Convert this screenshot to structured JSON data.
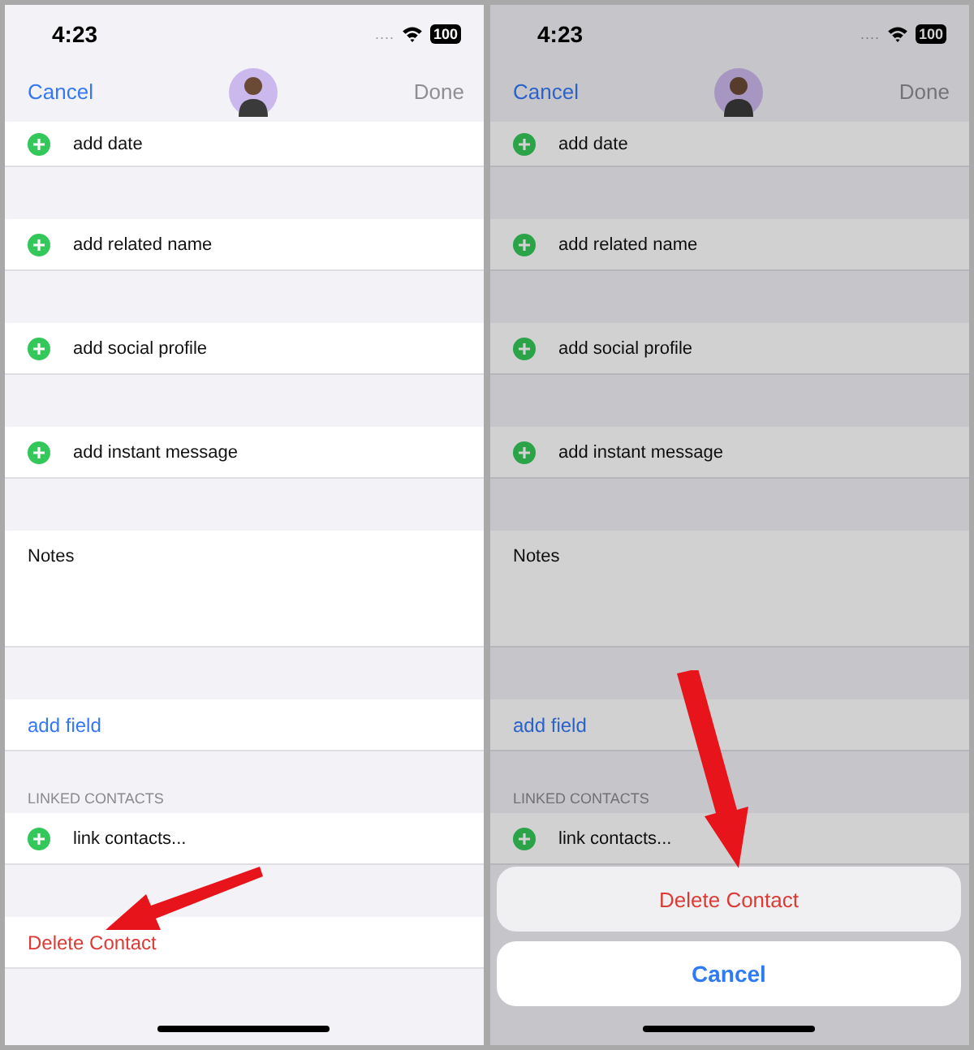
{
  "screens": [
    {
      "status": {
        "time": "4:23",
        "signal": "....",
        "battery": "100"
      },
      "nav": {
        "cancel": "Cancel",
        "done": "Done",
        "done_disabled": true
      },
      "dimmed": false,
      "groups": [
        {
          "rows": [
            {
              "kind": "add",
              "label": "add date"
            }
          ]
        },
        {
          "rows": [
            {
              "kind": "add",
              "label": "add related name"
            }
          ]
        },
        {
          "rows": [
            {
              "kind": "add",
              "label": "add social profile"
            }
          ]
        },
        {
          "rows": [
            {
              "kind": "add",
              "label": "add instant message"
            }
          ]
        },
        {
          "rows": [
            {
              "kind": "notes",
              "label": "Notes"
            }
          ]
        },
        {
          "rows": [
            {
              "kind": "link",
              "label": "add field"
            }
          ]
        },
        {
          "header": "LINKED CONTACTS",
          "rows": [
            {
              "kind": "add",
              "label": "link contacts..."
            }
          ]
        },
        {
          "rows": [
            {
              "kind": "destructive",
              "label": "Delete Contact"
            }
          ]
        }
      ]
    },
    {
      "status": {
        "time": "4:23",
        "signal": "....",
        "battery": "100"
      },
      "nav": {
        "cancel": "Cancel",
        "done": "Done",
        "done_disabled": true
      },
      "dimmed": true,
      "groups": [
        {
          "rows": [
            {
              "kind": "add",
              "label": "add date"
            }
          ]
        },
        {
          "rows": [
            {
              "kind": "add",
              "label": "add related name"
            }
          ]
        },
        {
          "rows": [
            {
              "kind": "add",
              "label": "add social profile"
            }
          ]
        },
        {
          "rows": [
            {
              "kind": "add",
              "label": "add instant message"
            }
          ]
        },
        {
          "rows": [
            {
              "kind": "notes",
              "label": "Notes"
            }
          ]
        },
        {
          "rows": [
            {
              "kind": "link",
              "label": "add field"
            }
          ]
        },
        {
          "header": "LINKED CONTACTS",
          "rows": [
            {
              "kind": "add",
              "label": "link contacts..."
            }
          ]
        }
      ],
      "action_sheet": {
        "actions": [
          {
            "kind": "destructive",
            "label": "Delete Contact"
          }
        ],
        "cancel": "Cancel"
      }
    }
  ]
}
